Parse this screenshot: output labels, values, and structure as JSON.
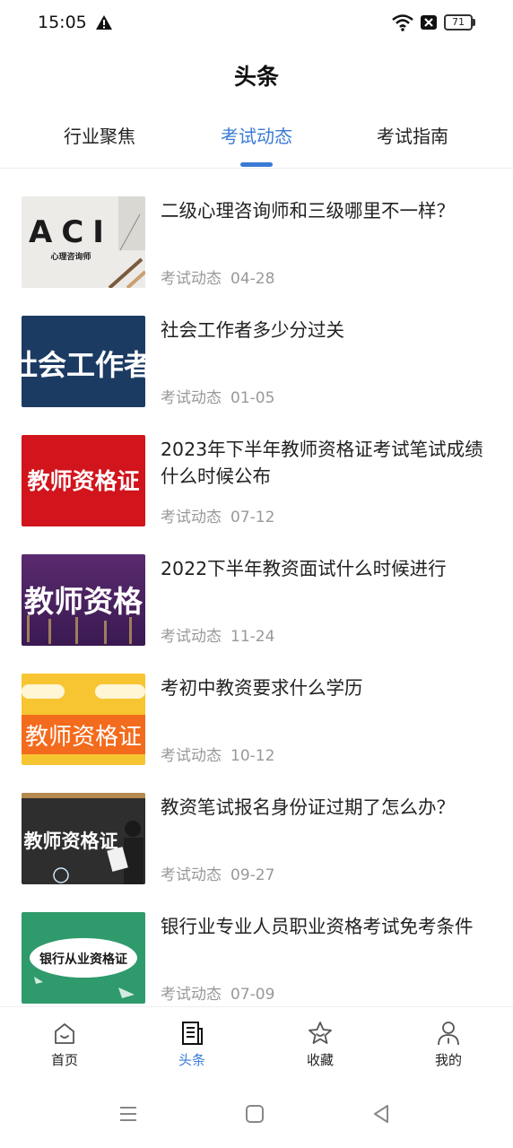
{
  "status": {
    "time": "15:05",
    "battery": "71"
  },
  "header": {
    "title": "头条"
  },
  "tabs": [
    {
      "label": "行业聚焦",
      "active": false
    },
    {
      "label": "考试动态",
      "active": true
    },
    {
      "label": "考试指南",
      "active": false
    }
  ],
  "news": [
    {
      "title": "二级心理咨询师和三级哪里不一样？",
      "category": "考试动态",
      "date": "04-28",
      "thumb_text": "ACI",
      "thumb_subtext": "心理咨询师"
    },
    {
      "title": "社会工作者多少分过关",
      "category": "考试动态",
      "date": "01-05",
      "thumb_text": "社会工作者"
    },
    {
      "title": "2023年下半年教师资格证考试笔试成绩什么时候公布",
      "category": "考试动态",
      "date": "07-12",
      "thumb_text": "教师资格证"
    },
    {
      "title": "2022下半年教资面试什么时候进行",
      "category": "考试动态",
      "date": "11-24",
      "thumb_text": "教师资格"
    },
    {
      "title": "考初中教资要求什么学历",
      "category": "考试动态",
      "date": "10-12",
      "thumb_text": "教师资格证"
    },
    {
      "title": "教资笔试报名身份证过期了怎么办？",
      "category": "考试动态",
      "date": "09-27",
      "thumb_text": "教师资格证"
    },
    {
      "title": "银行业专业人员职业资格考试免考条件",
      "category": "考试动态",
      "date": "07-09",
      "thumb_text": "银行从业资格证"
    }
  ],
  "bottom_nav": [
    {
      "label": "首页",
      "icon": "home-icon",
      "active": false
    },
    {
      "label": "头条",
      "icon": "news-icon",
      "active": true
    },
    {
      "label": "收藏",
      "icon": "star-icon",
      "active": false
    },
    {
      "label": "我的",
      "icon": "profile-icon",
      "active": false
    }
  ],
  "colors": {
    "accent": "#3a7bd5",
    "meta_text": "#999999"
  }
}
